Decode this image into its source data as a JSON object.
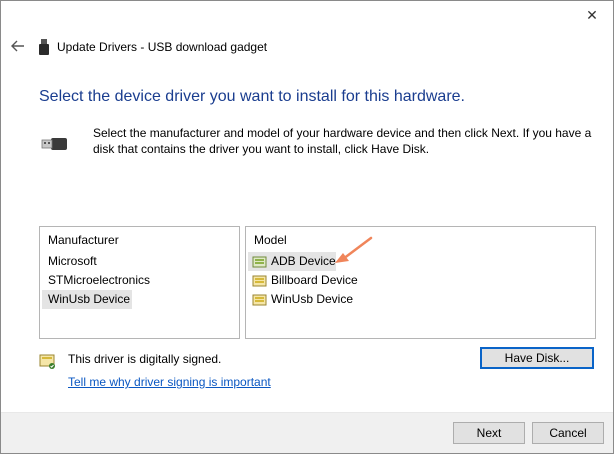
{
  "window": {
    "title": "Update Drivers - USB download gadget",
    "close_glyph": "✕"
  },
  "heading": "Select the device driver you want to install for this hardware.",
  "description": "Select the manufacturer and model of your hardware device and then click Next. If you have a disk that contains the driver you want to install, click Have Disk.",
  "manufacturer": {
    "header": "Manufacturer",
    "items": [
      "Microsoft",
      "STMicroelectronics",
      "WinUsb Device"
    ],
    "selected": "WinUsb Device"
  },
  "model": {
    "header": "Model",
    "items": [
      "ADB Device",
      "Billboard Device",
      "WinUsb Device"
    ],
    "selected": "ADB Device"
  },
  "signing": {
    "status": "This driver is digitally signed.",
    "link": "Tell me why driver signing is important"
  },
  "buttons": {
    "have_disk": "Have Disk...",
    "next": "Next",
    "cancel": "Cancel"
  },
  "colors": {
    "heading": "#1a3d8f",
    "link": "#0a57c2",
    "accent_border": "#0a64c8",
    "annotation_arrow": "#f0855a"
  },
  "icons": {
    "back": "back-arrow-icon",
    "device": "usb-device-icon",
    "driver": "driver-package-icon",
    "signed": "signed-certificate-icon"
  }
}
